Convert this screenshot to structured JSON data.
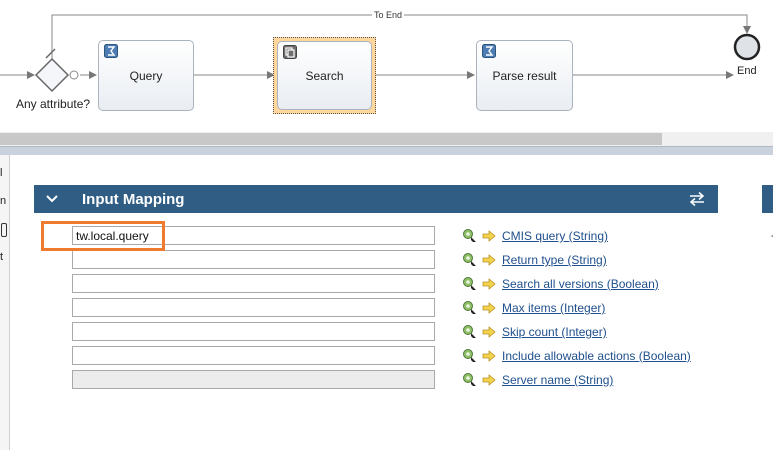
{
  "diagram": {
    "gateway_label": "Any attribute?",
    "end_label": "End",
    "to_end_label": "To End",
    "tasks": [
      {
        "label": "Query",
        "icon": "script-icon",
        "selected": false
      },
      {
        "label": "Search",
        "icon": "service-icon",
        "selected": true
      },
      {
        "label": "Parse result",
        "icon": "script-icon",
        "selected": false
      }
    ]
  },
  "left_strip": {
    "tabs": [
      "l",
      "n",
      "",
      "t"
    ]
  },
  "right_strip": {
    "text": "-"
  },
  "panel": {
    "title": "Input Mapping",
    "header_color": "#2f5d84",
    "highlight_color": "#f07a2e",
    "mappings": [
      {
        "value": "tw.local.query",
        "parameter": "CMIS query (String)",
        "disabled": false
      },
      {
        "value": "",
        "parameter": "Return type (String)",
        "disabled": false
      },
      {
        "value": "",
        "parameter": "Search all versions (Boolean)",
        "disabled": false
      },
      {
        "value": "",
        "parameter": "Max items (Integer)",
        "disabled": false
      },
      {
        "value": "",
        "parameter": "Skip count (Integer)",
        "disabled": false
      },
      {
        "value": "",
        "parameter": "Include allowable actions (Boolean)",
        "disabled": false
      },
      {
        "value": "",
        "parameter": "Server name (String)",
        "disabled": true
      }
    ]
  }
}
